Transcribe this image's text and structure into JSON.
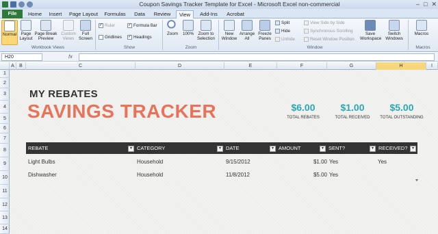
{
  "window": {
    "title": "Coupon Savings Tracker Template for Excel  -  Microsoft Excel non-commercial use",
    "controls": [
      "–",
      "□",
      "✕"
    ]
  },
  "tabs": [
    "File",
    "Home",
    "Insert",
    "Page Layout",
    "Formulas",
    "Data",
    "Review",
    "View",
    "Add-Ins",
    "Acrobat"
  ],
  "ribbon": {
    "workbook_views": {
      "normal": "Normal",
      "page_layout": "Page Layout",
      "page_break": "Page Break Preview",
      "custom_views": "Custom Views",
      "full_screen": "Full Screen",
      "group": "Workbook Views"
    },
    "show": {
      "ruler": "Ruler",
      "gridlines": "Gridlines",
      "formula_bar": "Formula Bar",
      "headings": "Headings",
      "group": "Show"
    },
    "zoom": {
      "zoom": "Zoom",
      "zoom100": "100%",
      "zoom_selection": "Zoom to Selection",
      "group": "Zoom"
    },
    "window": {
      "new_window": "New Window",
      "arrange_all": "Arrange All",
      "freeze_panes": "Freeze Panes",
      "split": "Split",
      "hide": "Hide",
      "unhide": "Unhide",
      "side_by_side": "View Side by Side",
      "sync_scroll": "Synchronous Scrolling",
      "reset_position": "Reset Window Position",
      "save_workspace": "Save Workspace",
      "switch_windows": "Switch Windows",
      "group": "Window"
    },
    "macros": {
      "macros": "Macros",
      "group": "Macros"
    }
  },
  "formula_bar": {
    "name_box": "H20",
    "fx": "fx",
    "value": ""
  },
  "columns": [
    "A",
    "B",
    "C",
    "D",
    "E",
    "F",
    "G",
    "H",
    "I"
  ],
  "rows": [
    "1",
    "2",
    "3",
    "4",
    "5",
    "6",
    "7",
    "8",
    "9",
    "10",
    "11",
    "12",
    "13",
    "14"
  ],
  "sheet": {
    "heading": "MY REBATES",
    "title": "SAVINGS TRACKER",
    "stats": [
      {
        "value": "$6.00",
        "label": "TOTAL REBATES"
      },
      {
        "value": "$1.00",
        "label": "TOTAL RECEIVED"
      },
      {
        "value": "$5.00",
        "label": "TOTAL OUTSTANDING"
      }
    ],
    "table_headers": [
      "REBATE",
      "CATEGORY",
      "DATE",
      "AMOUNT",
      "SENT?",
      "RECEIVED?"
    ],
    "rows": [
      {
        "rebate": "Light Bulbs",
        "category": "Household",
        "date": "9/15/2012",
        "amount": "$1.00",
        "sent": "Yes",
        "received": "Yes"
      },
      {
        "rebate": "Dishwasher",
        "category": "Household",
        "date": "11/8/2012",
        "amount": "$5.00",
        "sent": "Yes",
        "received": ""
      }
    ]
  },
  "colors": {
    "accent_orange": "#e8735a",
    "accent_teal": "#2aa8b5",
    "header_dark": "#333333",
    "file_tab": "#2d7a3a"
  }
}
